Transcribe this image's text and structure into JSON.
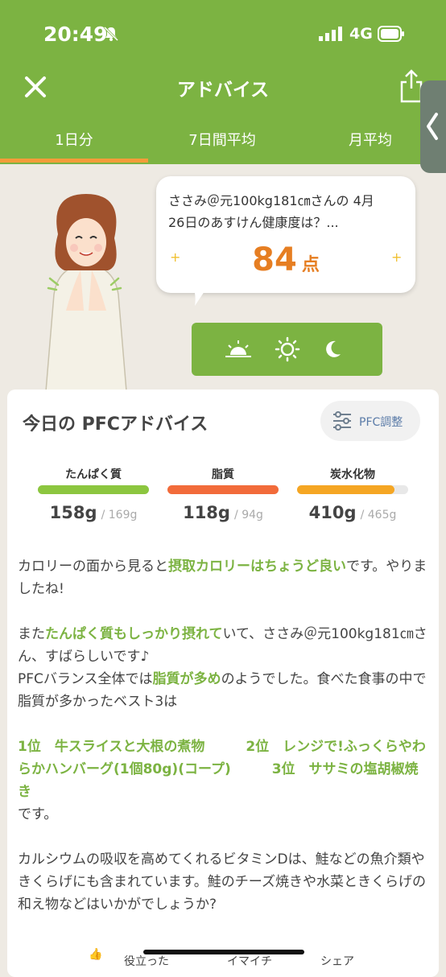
{
  "status": {
    "time": "20:49",
    "network": "4G"
  },
  "header": {
    "title": "アドバイス"
  },
  "tabs": [
    {
      "label": "1日分"
    },
    {
      "label": "7日間平均"
    },
    {
      "label": "月平均"
    }
  ],
  "colors": {
    "brand": "#7cb342",
    "accent": "#e67e22",
    "tab_indicator": "#f39c3a"
  },
  "summary": {
    "line1": "ささみ＠元100kg181㎝さんの 4月",
    "line2": "26日のあすけん健康度は？...",
    "score": "84",
    "score_unit": "点"
  },
  "time_buttons": [
    {
      "icon": "sunrise-icon"
    },
    {
      "icon": "sun-icon"
    },
    {
      "icon": "moon-icon"
    }
  ],
  "pfc": {
    "title": "今日の PFCアドバイス",
    "adjust_label": "PFC調整",
    "nutrients": [
      {
        "name": "たんぱく質",
        "value": "158g",
        "target": "/ 169g",
        "progress": 1.0,
        "color": "#8cc63f"
      },
      {
        "name": "脂質",
        "value": "118g",
        "target": "/ 94g",
        "progress": 1.0,
        "color": "#f26b3a"
      },
      {
        "name": "炭水化物",
        "value": "410g",
        "target": "/ 465g",
        "progress": 0.88,
        "color": "#f5a623"
      }
    ]
  },
  "advice": {
    "p1a": "カロリーの面から見ると",
    "p1hl": "摂取カロリーはちょうど良い",
    "p1b": "です。やりましたね!",
    "p2a": "また",
    "p2hl": "たんぱく質もしっかり摂れて",
    "p2b": "いて、ささみ＠元100kg181㎝さん、すばらしいです♪",
    "p2c": "PFCバランス全体では",
    "p2hl2": "脂質が多め",
    "p2d": "のようでした。食べた食事の中で脂質が多かったベスト3は",
    "p3hl": "1位　牛スライスと大根の煮物　　　2位　レンジで!ふっくらやわらかハンバーグ(1個80g)(コープ)　　　3位　ササミの塩胡椒焼き",
    "p3b": "です。",
    "p4": "カルシウムの吸収を高めてくれるビタミンDは、鮭などの魚介類やきくらげにも含まれています。鮭のチーズ焼きや水菜ときくらげの和え物などはいかがでしょうか?"
  },
  "footer": {
    "helpful": "役立った",
    "meh": "イマイチ",
    "share": "シェア"
  }
}
